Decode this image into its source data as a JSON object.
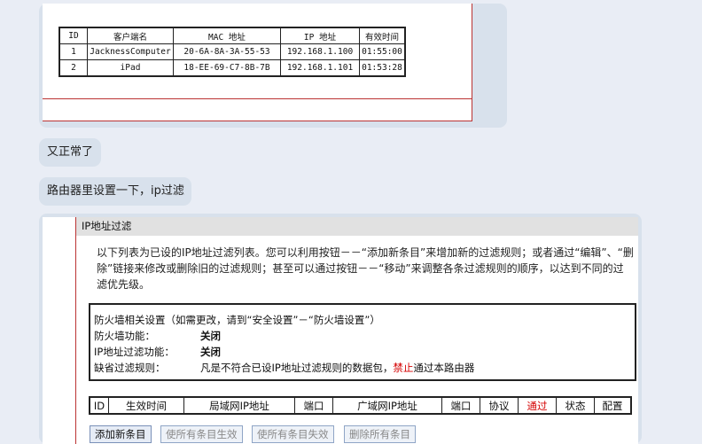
{
  "dhcp_table": {
    "headers": [
      "ID",
      "客户端名",
      "MAC 地址",
      "IP 地址",
      "有效时间"
    ],
    "rows": [
      [
        "1",
        "JacknessComputer",
        "20-6A-8A-3A-55-53",
        "192.168.1.100",
        "01:55:00"
      ],
      [
        "2",
        "iPad",
        "18-EE-69-C7-8B-7B",
        "192.168.1.101",
        "01:53:28"
      ]
    ]
  },
  "messages": [
    {
      "text": "又正常了"
    },
    {
      "text": "路由器里设置一下，ip过滤"
    }
  ],
  "ip_filter": {
    "title": "IP地址过滤",
    "description": "以下列表为已设的IP地址过滤列表。您可以利用按钮－－“添加新条目”来增加新的过滤规则；或者通过“编辑”、“删除”链接来修改或删除旧的过滤规则；甚至可以通过按钮－－“移动”来调整各条过滤规则的顺序，以达到不同的过滤优先级。",
    "firewall": {
      "heading": "防火墙相关设置（如需更改，请到“安全设置”－“防火墙设置”）",
      "firewall_label": "防火墙功能：",
      "firewall_value": "关闭",
      "ipfilter_label": "IP地址过滤功能：",
      "ipfilter_value": "关闭",
      "default_label": "缺省过滤规则：",
      "default_prefix": "凡是不符合已设IP地址过滤规则的数据包，",
      "default_forbid": "禁止",
      "default_suffix": "通过本路由器"
    },
    "columns": [
      "ID",
      "生效时间",
      "局域网IP地址",
      "端口",
      "广域网IP地址",
      "端口",
      "协议",
      "通过",
      "状态",
      "配置"
    ],
    "highlight_column_color": "#d40000",
    "buttons": {
      "add": "添加新条目",
      "enable_all": "使所有条目生效",
      "disable_all": "使所有条目失效",
      "delete_all": "删除所有条目"
    }
  }
}
